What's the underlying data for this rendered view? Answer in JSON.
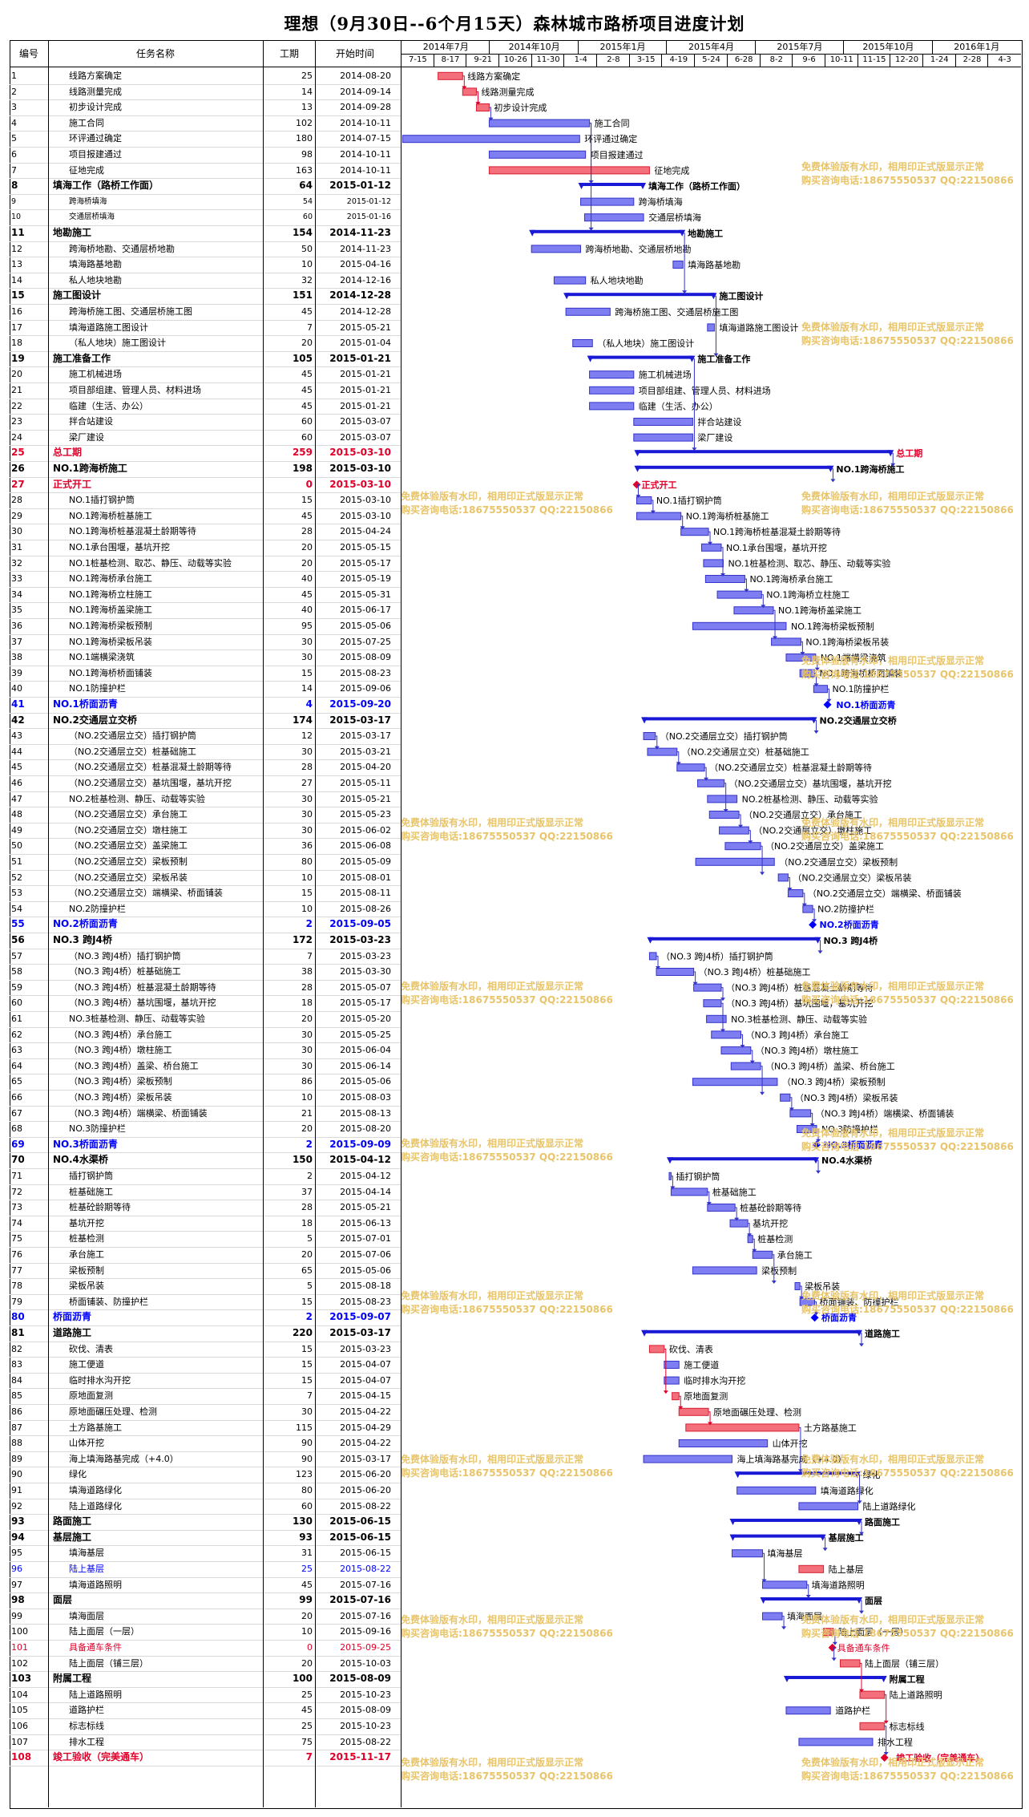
{
  "title": "理想（9月30日--6个月15天）森林城市路桥项目进度计划",
  "columns": {
    "id": "编号",
    "name": "任务名称",
    "dur": "工期",
    "date": "开始时间"
  },
  "timeline_months": [
    "2014年7月",
    "2014年10月",
    "2015年1月",
    "2015年4月",
    "2015年7月",
    "2015年10月",
    "2016年1月"
  ],
  "timeline_weeks": [
    "7-15",
    "8-17",
    "9-21",
    "10-26",
    "11-30",
    "1-4",
    "2-8",
    "3-15",
    "4-19",
    "5-24",
    "6-28",
    "8-2",
    "9-6",
    "10-11",
    "11-15",
    "12-20",
    "1-24",
    "2-28",
    "4-3"
  ],
  "watermark": {
    "line1": "免费体验版有水印，相用印正式版显示正常",
    "line2": "购买咨询电话:18675550537 QQ:22150866"
  },
  "chart_data": {
    "type": "gantt",
    "title": "理想（9月30日--6个月15天）森林城市路桥项目进度计划",
    "x_unit": "date",
    "xlim": [
      "2014-07-13",
      "2016-04-03"
    ],
    "tasks": [
      {
        "id": "1",
        "name": "线路方案确定",
        "dur": 25,
        "start": "2014-08-20",
        "style": "normal",
        "bar": "red"
      },
      {
        "id": "2",
        "name": "线路测量完成",
        "dur": 14,
        "start": "2014-09-14",
        "style": "normal",
        "bar": "red"
      },
      {
        "id": "3",
        "name": "初步设计完成",
        "dur": 13,
        "start": "2014-09-28",
        "style": "normal",
        "bar": "red"
      },
      {
        "id": "4",
        "name": "施工合同",
        "dur": 102,
        "start": "2014-10-11",
        "style": "normal",
        "bar": "blue"
      },
      {
        "id": "5",
        "name": "环评通过确定",
        "dur": 180,
        "start": "2014-07-15",
        "style": "normal",
        "bar": "blue"
      },
      {
        "id": "6",
        "name": "项目报建通过",
        "dur": 98,
        "start": "2014-10-11",
        "style": "normal",
        "bar": "blue"
      },
      {
        "id": "7",
        "name": "征地完成",
        "dur": 163,
        "start": "2014-10-11",
        "style": "normal",
        "bar": "red"
      },
      {
        "id": "8",
        "name": "填海工作（路桥工作面）",
        "dur": 64,
        "start": "2015-01-12",
        "style": "bold",
        "bar": "summary"
      },
      {
        "id": "9",
        "name": "跨海桥填海",
        "dur": 54,
        "start": "2015-01-12",
        "style": "small",
        "bar": "blue"
      },
      {
        "id": "10",
        "name": "交通层桥填海",
        "dur": 60,
        "start": "2015-01-16",
        "style": "small",
        "bar": "blue"
      },
      {
        "id": "11",
        "name": "地勘施工",
        "dur": 154,
        "start": "2014-11-23",
        "style": "bold",
        "bar": "summary"
      },
      {
        "id": "12",
        "name": "跨海桥地勘、交通层桥地勘",
        "dur": 50,
        "start": "2014-11-23",
        "style": "normal",
        "bar": "blue"
      },
      {
        "id": "13",
        "name": "填海路基地勘",
        "dur": 10,
        "start": "2015-04-16",
        "style": "normal",
        "bar": "blue"
      },
      {
        "id": "14",
        "name": "私人地块地勘",
        "dur": 32,
        "start": "2014-12-16",
        "style": "normal",
        "bar": "blue"
      },
      {
        "id": "15",
        "name": "施工图设计",
        "dur": 151,
        "start": "2014-12-28",
        "style": "bold",
        "bar": "summary"
      },
      {
        "id": "16",
        "name": "跨海桥施工图、交通层桥施工图",
        "dur": 45,
        "start": "2014-12-28",
        "style": "normal",
        "bar": "blue"
      },
      {
        "id": "17",
        "name": "填海道路施工图设计",
        "dur": 7,
        "start": "2015-05-21",
        "style": "normal",
        "bar": "blue"
      },
      {
        "id": "18",
        "name": "（私人地块）施工图设计",
        "dur": 20,
        "start": "2015-01-04",
        "style": "normal",
        "bar": "blue"
      },
      {
        "id": "19",
        "name": "施工准备工作",
        "dur": 105,
        "start": "2015-01-21",
        "style": "bold",
        "bar": "summary"
      },
      {
        "id": "20",
        "name": "施工机械进场",
        "dur": 45,
        "start": "2015-01-21",
        "style": "normal",
        "bar": "blue"
      },
      {
        "id": "21",
        "name": "项目部组建、管理人员、材料进场",
        "dur": 45,
        "start": "2015-01-21",
        "style": "normal",
        "bar": "blue"
      },
      {
        "id": "22",
        "name": "临建（生活、办公）",
        "dur": 45,
        "start": "2015-01-21",
        "style": "normal",
        "bar": "blue"
      },
      {
        "id": "23",
        "name": "拌合站建设",
        "dur": 60,
        "start": "2015-03-07",
        "style": "normal",
        "bar": "blue"
      },
      {
        "id": "24",
        "name": "梁厂建设",
        "dur": 60,
        "start": "2015-03-07",
        "style": "normal",
        "bar": "blue"
      },
      {
        "id": "25",
        "name": "总工期",
        "dur": 259,
        "start": "2015-03-10",
        "style": "red",
        "bar": "summary"
      },
      {
        "id": "26",
        "name": "NO.1跨海桥施工",
        "dur": 198,
        "start": "2015-03-10",
        "style": "bold",
        "bar": "summary"
      },
      {
        "id": "27",
        "name": "正式开工",
        "dur": 0,
        "start": "2015-03-10",
        "style": "red",
        "bar": "milestone"
      },
      {
        "id": "28",
        "name": "NO.1插打钢护筒",
        "dur": 15,
        "start": "2015-03-10",
        "style": "normal",
        "bar": "blue"
      },
      {
        "id": "29",
        "name": "NO.1跨海桥桩基施工",
        "dur": 45,
        "start": "2015-03-10",
        "style": "normal",
        "bar": "blue"
      },
      {
        "id": "30",
        "name": "NO.1跨海桥桩基混凝土龄期等待",
        "dur": 28,
        "start": "2015-04-24",
        "style": "normal",
        "bar": "blue"
      },
      {
        "id": "31",
        "name": "NO.1承台围堰，基坑开挖",
        "dur": 20,
        "start": "2015-05-15",
        "style": "normal",
        "bar": "blue"
      },
      {
        "id": "32",
        "name": "NO.1桩基检测、取芯、静压、动载等实验",
        "dur": 20,
        "start": "2015-05-17",
        "style": "normal",
        "bar": "blue"
      },
      {
        "id": "33",
        "name": "NO.1跨海桥承台施工",
        "dur": 40,
        "start": "2015-05-19",
        "style": "normal",
        "bar": "blue"
      },
      {
        "id": "34",
        "name": "NO.1跨海桥立柱施工",
        "dur": 45,
        "start": "2015-05-31",
        "style": "normal",
        "bar": "blue"
      },
      {
        "id": "35",
        "name": "NO.1跨海桥盖梁施工",
        "dur": 40,
        "start": "2015-06-17",
        "style": "normal",
        "bar": "blue"
      },
      {
        "id": "36",
        "name": "NO.1跨海桥梁板预制",
        "dur": 95,
        "start": "2015-05-06",
        "style": "normal",
        "bar": "blue"
      },
      {
        "id": "37",
        "name": "NO.1跨海桥梁板吊装",
        "dur": 30,
        "start": "2015-07-25",
        "style": "normal",
        "bar": "blue"
      },
      {
        "id": "38",
        "name": "NO.1端横梁浇筑",
        "dur": 30,
        "start": "2015-08-09",
        "style": "normal",
        "bar": "blue"
      },
      {
        "id": "39",
        "name": "NO.1跨海桥桥面铺装",
        "dur": 15,
        "start": "2015-08-23",
        "style": "normal",
        "bar": "blue"
      },
      {
        "id": "40",
        "name": "NO.1防撞护栏",
        "dur": 14,
        "start": "2015-09-06",
        "style": "normal",
        "bar": "blue"
      },
      {
        "id": "41",
        "name": "NO.1桥面沥青",
        "dur": 4,
        "start": "2015-09-20",
        "style": "blue",
        "bar": "milestone-blue"
      },
      {
        "id": "42",
        "name": "NO.2交通层立交桥",
        "dur": 174,
        "start": "2015-03-17",
        "style": "bold",
        "bar": "summary"
      },
      {
        "id": "43",
        "name": "（NO.2交通层立交）插打钢护筒",
        "dur": 12,
        "start": "2015-03-17",
        "style": "normal",
        "bar": "blue"
      },
      {
        "id": "44",
        "name": "（NO.2交通层立交）桩基础施工",
        "dur": 30,
        "start": "2015-03-21",
        "style": "normal",
        "bar": "blue"
      },
      {
        "id": "45",
        "name": "（NO.2交通层立交）桩基混凝土龄期等待",
        "dur": 28,
        "start": "2015-04-20",
        "style": "normal",
        "bar": "blue"
      },
      {
        "id": "46",
        "name": "（NO.2交通层立交）基坑围堰，基坑开挖",
        "dur": 27,
        "start": "2015-05-11",
        "style": "normal",
        "bar": "blue"
      },
      {
        "id": "47",
        "name": "NO.2桩基检测、静压、动载等实验",
        "dur": 30,
        "start": "2015-05-21",
        "style": "normal",
        "bar": "blue"
      },
      {
        "id": "48",
        "name": "（NO.2交通层立交）承台施工",
        "dur": 30,
        "start": "2015-05-23",
        "style": "normal",
        "bar": "blue"
      },
      {
        "id": "49",
        "name": "（NO.2交通层立交）墩柱施工",
        "dur": 30,
        "start": "2015-06-02",
        "style": "normal",
        "bar": "blue"
      },
      {
        "id": "50",
        "name": "（NO.2交通层立交）盖梁施工",
        "dur": 36,
        "start": "2015-06-08",
        "style": "normal",
        "bar": "blue"
      },
      {
        "id": "51",
        "name": "（NO.2交通层立交）梁板预制",
        "dur": 80,
        "start": "2015-05-09",
        "style": "normal",
        "bar": "blue"
      },
      {
        "id": "52",
        "name": "（NO.2交通层立交）梁板吊装",
        "dur": 10,
        "start": "2015-08-01",
        "style": "normal",
        "bar": "blue"
      },
      {
        "id": "53",
        "name": "（NO.2交通层立交）端横梁、桥面铺装",
        "dur": 15,
        "start": "2015-08-11",
        "style": "normal",
        "bar": "blue"
      },
      {
        "id": "54",
        "name": "NO.2防撞护栏",
        "dur": 10,
        "start": "2015-08-26",
        "style": "normal",
        "bar": "blue"
      },
      {
        "id": "55",
        "name": "NO.2桥面沥青",
        "dur": 2,
        "start": "2015-09-05",
        "style": "blue",
        "bar": "milestone-blue"
      },
      {
        "id": "56",
        "name": "NO.3 跨J4桥",
        "dur": 172,
        "start": "2015-03-23",
        "style": "bold",
        "bar": "summary"
      },
      {
        "id": "57",
        "name": "（NO.3 跨J4桥）插打钢护筒",
        "dur": 7,
        "start": "2015-03-23",
        "style": "normal",
        "bar": "blue"
      },
      {
        "id": "58",
        "name": "（NO.3 跨J4桥）桩基础施工",
        "dur": 38,
        "start": "2015-03-30",
        "style": "normal",
        "bar": "blue"
      },
      {
        "id": "59",
        "name": "（NO.3 跨J4桥）桩基混凝土龄期等待",
        "dur": 28,
        "start": "2015-05-07",
        "style": "normal",
        "bar": "blue"
      },
      {
        "id": "60",
        "name": "（NO.3 跨J4桥）基坑围堰，基坑开挖",
        "dur": 18,
        "start": "2015-05-17",
        "style": "normal",
        "bar": "blue"
      },
      {
        "id": "61",
        "name": "NO.3桩基检测、静压、动载等实验",
        "dur": 20,
        "start": "2015-05-20",
        "style": "normal",
        "bar": "blue"
      },
      {
        "id": "62",
        "name": "（NO.3 跨J4桥）承台施工",
        "dur": 30,
        "start": "2015-05-25",
        "style": "normal",
        "bar": "blue"
      },
      {
        "id": "63",
        "name": "（NO.3 跨J4桥）墩柱施工",
        "dur": 30,
        "start": "2015-06-04",
        "style": "normal",
        "bar": "blue"
      },
      {
        "id": "64",
        "name": "（NO.3 跨J4桥）盖梁、桥台施工",
        "dur": 30,
        "start": "2015-06-14",
        "style": "normal",
        "bar": "blue"
      },
      {
        "id": "65",
        "name": "（NO.3 跨J4桥）梁板预制",
        "dur": 86,
        "start": "2015-05-06",
        "style": "normal",
        "bar": "blue"
      },
      {
        "id": "66",
        "name": "（NO.3 跨J4桥）梁板吊装",
        "dur": 10,
        "start": "2015-08-03",
        "style": "normal",
        "bar": "blue"
      },
      {
        "id": "67",
        "name": "（NO.3 跨J4桥）端横梁、桥面铺装",
        "dur": 21,
        "start": "2015-08-13",
        "style": "normal",
        "bar": "blue"
      },
      {
        "id": "68",
        "name": "NO.3防撞护栏",
        "dur": 20,
        "start": "2015-08-20",
        "style": "normal",
        "bar": "blue"
      },
      {
        "id": "69",
        "name": "NO.3桥面沥青",
        "dur": 2,
        "start": "2015-09-09",
        "style": "blue",
        "bar": "milestone-blue"
      },
      {
        "id": "70",
        "name": "NO.4水渠桥",
        "dur": 150,
        "start": "2015-04-12",
        "style": "bold",
        "bar": "summary"
      },
      {
        "id": "71",
        "name": "插打钢护筒",
        "dur": 2,
        "start": "2015-04-12",
        "style": "normal",
        "bar": "blue"
      },
      {
        "id": "72",
        "name": "桩基础施工",
        "dur": 37,
        "start": "2015-04-14",
        "style": "normal",
        "bar": "blue"
      },
      {
        "id": "73",
        "name": "桩基砼龄期等待",
        "dur": 28,
        "start": "2015-05-21",
        "style": "normal",
        "bar": "blue"
      },
      {
        "id": "74",
        "name": "基坑开挖",
        "dur": 18,
        "start": "2015-06-13",
        "style": "normal",
        "bar": "blue"
      },
      {
        "id": "75",
        "name": "桩基检测",
        "dur": 5,
        "start": "2015-07-01",
        "style": "normal",
        "bar": "blue"
      },
      {
        "id": "76",
        "name": "承台施工",
        "dur": 20,
        "start": "2015-07-06",
        "style": "normal",
        "bar": "blue"
      },
      {
        "id": "77",
        "name": "梁板预制",
        "dur": 65,
        "start": "2015-05-06",
        "style": "normal",
        "bar": "blue"
      },
      {
        "id": "78",
        "name": "梁板吊装",
        "dur": 5,
        "start": "2015-08-18",
        "style": "normal",
        "bar": "blue"
      },
      {
        "id": "79",
        "name": "桥面铺装、防撞护栏",
        "dur": 15,
        "start": "2015-08-23",
        "style": "normal",
        "bar": "blue"
      },
      {
        "id": "80",
        "name": "桥面沥青",
        "dur": 2,
        "start": "2015-09-07",
        "style": "blue",
        "bar": "milestone-blue"
      },
      {
        "id": "81",
        "name": "道路施工",
        "dur": 220,
        "start": "2015-03-17",
        "style": "bold",
        "bar": "summary"
      },
      {
        "id": "82",
        "name": "砍伐、清表",
        "dur": 15,
        "start": "2015-03-23",
        "style": "normal",
        "bar": "red"
      },
      {
        "id": "83",
        "name": "施工便道",
        "dur": 15,
        "start": "2015-04-07",
        "style": "normal",
        "bar": "blue"
      },
      {
        "id": "84",
        "name": "临时排水沟开挖",
        "dur": 15,
        "start": "2015-04-07",
        "style": "normal",
        "bar": "blue"
      },
      {
        "id": "85",
        "name": "原地面复测",
        "dur": 7,
        "start": "2015-04-15",
        "style": "normal",
        "bar": "red"
      },
      {
        "id": "86",
        "name": "原地面碾压处理、检测",
        "dur": 30,
        "start": "2015-04-22",
        "style": "normal",
        "bar": "red"
      },
      {
        "id": "87",
        "name": "土方路基施工",
        "dur": 115,
        "start": "2015-04-29",
        "style": "normal",
        "bar": "red"
      },
      {
        "id": "88",
        "name": "山体开挖",
        "dur": 90,
        "start": "2015-04-22",
        "style": "normal",
        "bar": "blue"
      },
      {
        "id": "89",
        "name": "海上填海路基完成（+4.0）",
        "dur": 90,
        "start": "2015-03-17",
        "style": "normal",
        "bar": "blue"
      },
      {
        "id": "90",
        "name": "绿化",
        "dur": 123,
        "start": "2015-06-20",
        "style": "normal",
        "bar": "summary"
      },
      {
        "id": "91",
        "name": "填海道路绿化",
        "dur": 80,
        "start": "2015-06-20",
        "style": "normal",
        "bar": "blue"
      },
      {
        "id": "92",
        "name": "陆上道路绿化",
        "dur": 60,
        "start": "2015-08-22",
        "style": "normal",
        "bar": "blue"
      },
      {
        "id": "93",
        "name": "路面施工",
        "dur": 130,
        "start": "2015-06-15",
        "style": "bold",
        "bar": "summary"
      },
      {
        "id": "94",
        "name": "基层施工",
        "dur": 93,
        "start": "2015-06-15",
        "style": "bold",
        "bar": "summary"
      },
      {
        "id": "95",
        "name": "填海基层",
        "dur": 31,
        "start": "2015-06-15",
        "style": "normal",
        "bar": "blue"
      },
      {
        "id": "96",
        "name": "陆上基层",
        "dur": 25,
        "start": "2015-08-22",
        "style": "bluelight",
        "bar": "red"
      },
      {
        "id": "97",
        "name": "填海道路照明",
        "dur": 45,
        "start": "2015-07-16",
        "style": "normal",
        "bar": "blue"
      },
      {
        "id": "98",
        "name": "面层",
        "dur": 99,
        "start": "2015-07-16",
        "style": "bold",
        "bar": "summary"
      },
      {
        "id": "99",
        "name": "填海面层",
        "dur": 20,
        "start": "2015-07-16",
        "style": "normal",
        "bar": "blue"
      },
      {
        "id": "100",
        "name": "陆上面层（一层）",
        "dur": 10,
        "start": "2015-09-16",
        "style": "normal",
        "bar": "red"
      },
      {
        "id": "101",
        "name": "具备通车条件",
        "dur": 0,
        "start": "2015-09-25",
        "style": "redlight",
        "bar": "milestone"
      },
      {
        "id": "102",
        "name": "陆上面层（铺三层）",
        "dur": 20,
        "start": "2015-10-03",
        "style": "normal",
        "bar": "red"
      },
      {
        "id": "103",
        "name": "附属工程",
        "dur": 100,
        "start": "2015-08-09",
        "style": "bold",
        "bar": "summary"
      },
      {
        "id": "104",
        "name": "陆上道路照明",
        "dur": 25,
        "start": "2015-10-23",
        "style": "normal",
        "bar": "red"
      },
      {
        "id": "105",
        "name": "道路护栏",
        "dur": 45,
        "start": "2015-08-09",
        "style": "normal",
        "bar": "blue"
      },
      {
        "id": "106",
        "name": "标志标线",
        "dur": 25,
        "start": "2015-10-23",
        "style": "normal",
        "bar": "red"
      },
      {
        "id": "107",
        "name": "排水工程",
        "dur": 75,
        "start": "2015-08-22",
        "style": "normal",
        "bar": "blue"
      },
      {
        "id": "108",
        "name": "竣工验收（完美通车）",
        "dur": 7,
        "start": "2015-11-17",
        "style": "red",
        "bar": "milestone"
      }
    ]
  }
}
